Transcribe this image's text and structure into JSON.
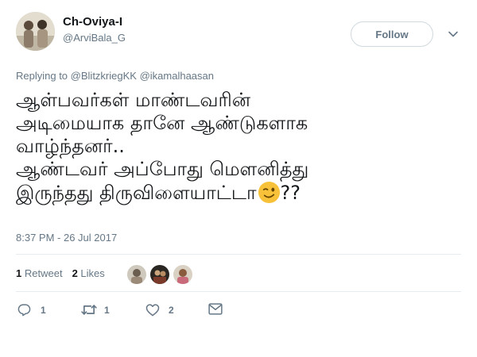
{
  "user": {
    "display_name": "Ch-Oviya-I",
    "handle": "@ArviBala_G"
  },
  "follow_label": "Follow",
  "reply_context": {
    "prefix": "Replying to",
    "mentions": [
      "@BlitzkriegKK",
      "@ikamalhaasan"
    ]
  },
  "tweet": {
    "lines": [
      "ஆள்பவர்கள் மாண்டவரின்",
      "அடிமையாக தானே ஆண்டுகளாக",
      "வாழ்ந்தனர்..",
      "ஆண்டவர் அப்போது மௌனித்து",
      "இருந்தது திருவிளையாட்டா"
    ],
    "suffix": "??"
  },
  "timestamp": "8:37 PM - 26 Jul 2017",
  "stats": {
    "retweets_count": "1",
    "retweets_label": "Retweet",
    "likes_count": "2",
    "likes_label": "Likes"
  },
  "actions": {
    "reply_count": "1",
    "retweet_count": "1",
    "like_count": "2"
  },
  "icons": {
    "avatar": "profile-photo",
    "chevron": "chevron-down-icon",
    "emoji": "winking-face-emoji",
    "reply": "reply-icon",
    "retweet": "retweet-icon",
    "like": "heart-icon",
    "dm": "envelope-icon"
  },
  "colors": {
    "text_primary": "#14171a",
    "text_secondary": "#657786",
    "border": "#e6ecf0",
    "follow_border": "#cfd9de",
    "emoji_yellow": "#f7c23a"
  }
}
